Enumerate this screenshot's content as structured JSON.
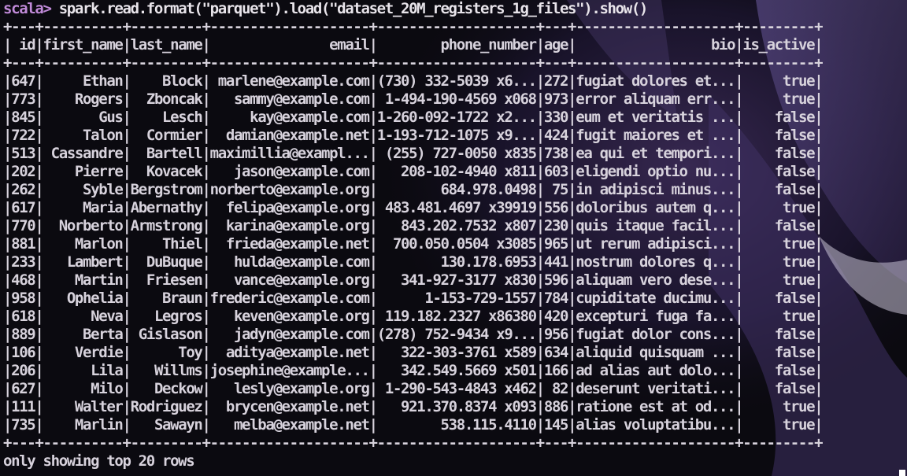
{
  "terminal": {
    "prompt": "scala>",
    "command": " spark.read.format(\"parquet\").load(\"dataset_20M_registers_1g_files\").show()",
    "footer": "only showing top 20 rows",
    "colors": {
      "prompt": "#c08ad8",
      "text": "#d7d2dc",
      "background": "#0b0a10"
    }
  },
  "table": {
    "columns": [
      "id",
      "first_name",
      "last_name",
      "email",
      "phone_number",
      "age",
      "bio",
      "is_active"
    ],
    "rows": [
      [
        "647",
        "Ethan",
        "Block",
        "marlene@example.com",
        "(730) 332-5039 x6...",
        "272",
        "fugiat dolores et...",
        "true"
      ],
      [
        "773",
        "Rogers",
        "Zboncak",
        "sammy@example.com",
        "1-494-190-4569 x068",
        "973",
        "error aliquam err...",
        "true"
      ],
      [
        "845",
        "Gus",
        "Lesch",
        "kay@example.com",
        "1-260-092-1722 x2...",
        "330",
        "eum et veritatis ...",
        "false"
      ],
      [
        "722",
        "Talon",
        "Cormier",
        "damian@example.net",
        "1-193-712-1075 x9...",
        "424",
        "fugit maiores et ...",
        "false"
      ],
      [
        "513",
        "Cassandre",
        "Bartell",
        "maximillia@exampl...",
        "(255) 727-0050 x835",
        "738",
        "ea qui et tempori...",
        "false"
      ],
      [
        "202",
        "Pierre",
        "Kovacek",
        "jason@example.com",
        "208-102-4940 x811",
        "603",
        "eligendi optio nu...",
        "false"
      ],
      [
        "262",
        "Syble",
        "Bergstrom",
        "norberto@example.org",
        "684.978.0498",
        "75",
        "in adipisci minus...",
        "false"
      ],
      [
        "617",
        "Maria",
        "Abernathy",
        "felipa@example.org",
        "483.481.4697 x39919",
        "556",
        "doloribus autem q...",
        "true"
      ],
      [
        "770",
        "Norberto",
        "Armstrong",
        "karina@example.org",
        "843.202.7532 x807",
        "230",
        "quis itaque facil...",
        "false"
      ],
      [
        "881",
        "Marlon",
        "Thiel",
        "frieda@example.net",
        "700.050.0504 x3085",
        "965",
        "ut rerum adipisci...",
        "true"
      ],
      [
        "233",
        "Lambert",
        "DuBuque",
        "hulda@example.com",
        "130.178.6953",
        "441",
        "nostrum dolores q...",
        "true"
      ],
      [
        "468",
        "Martin",
        "Friesen",
        "vance@example.org",
        "341-927-3177 x830",
        "596",
        "aliquam vero dese...",
        "true"
      ],
      [
        "958",
        "Ophelia",
        "Braun",
        "frederic@example.com",
        "1-153-729-1557",
        "784",
        "cupiditate ducimu...",
        "false"
      ],
      [
        "618",
        "Neva",
        "Legros",
        "keven@example.org",
        "119.182.2327 x86380",
        "420",
        "excepturi fuga fa...",
        "true"
      ],
      [
        "889",
        "Berta",
        "Gislason",
        "jadyn@example.com",
        "(278) 752-9434 x9...",
        "956",
        "fugiat dolor cons...",
        "false"
      ],
      [
        "106",
        "Verdie",
        "Toy",
        "aditya@example.net",
        "322-303-3761 x589",
        "634",
        "aliquid quisquam ...",
        "false"
      ],
      [
        "206",
        "Lila",
        "Willms",
        "josephine@example...",
        "342.549.5669 x501",
        "166",
        "ad alias aut dolo...",
        "false"
      ],
      [
        "627",
        "Milo",
        "Deckow",
        "lesly@example.org",
        "1-290-543-4843 x462",
        "82",
        "deserunt veritati...",
        "false"
      ],
      [
        "111",
        "Walter",
        "Rodriguez",
        "brycen@example.net",
        "921.370.8374 x093",
        "886",
        "ratione est at od...",
        "true"
      ],
      [
        "735",
        "Marlin",
        "Sawayn",
        "melba@example.net",
        "538.115.4110",
        "145",
        "alias voluptatibu...",
        "true"
      ]
    ]
  }
}
